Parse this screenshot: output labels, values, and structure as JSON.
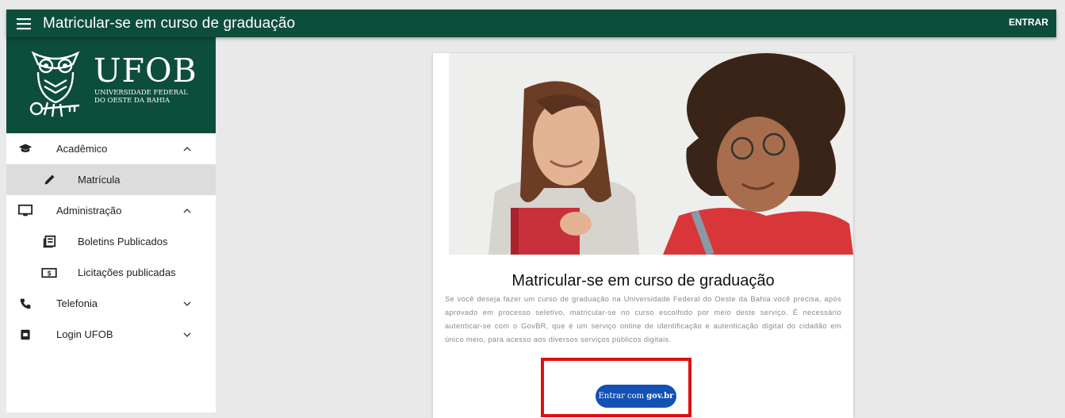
{
  "header": {
    "title": "Matricular-se em curso de graduação",
    "login_label": "ENTRAR"
  },
  "logo": {
    "name": "UFOB",
    "subtitle_line1": "UNIVERSIDADE FEDERAL",
    "subtitle_line2": "DO OESTE DA BAHIA"
  },
  "sidebar": {
    "items": [
      {
        "label": "Acadêmico",
        "icon": "graduation-cap-icon",
        "expanded": true
      },
      {
        "label": "Matrícula",
        "icon": "pencil-icon",
        "active": true
      },
      {
        "label": "Administração",
        "icon": "monitor-icon",
        "expanded": true
      },
      {
        "label": "Boletins Publicados",
        "icon": "newspaper-icon"
      },
      {
        "label": "Licitações publicadas",
        "icon": "money-icon"
      },
      {
        "label": "Telefonia",
        "icon": "phone-icon",
        "expanded": false
      },
      {
        "label": "Login UFOB",
        "icon": "badge-icon",
        "expanded": false
      }
    ]
  },
  "card": {
    "title": "Matricular-se em curso de graduação",
    "text": "Se você deseja fazer um curso de graduação na Universidade Federal do Oeste da Bahia você precisa, após aprovado em processo seletivo, matricular-se no curso escolhido por meio deste serviço. É necessário autenticar-se com o GovBR, que é um serviço online de identificação e autenticação digital do cidadão em único meio, para acesso aos diversos serviços públicos digitais.",
    "button_prefix": "Entrar com",
    "button_brand": "gov.br"
  },
  "colors": {
    "brand_green": "#0d4d3b",
    "gov_blue": "#1351b4",
    "highlight_red": "#e01010"
  }
}
